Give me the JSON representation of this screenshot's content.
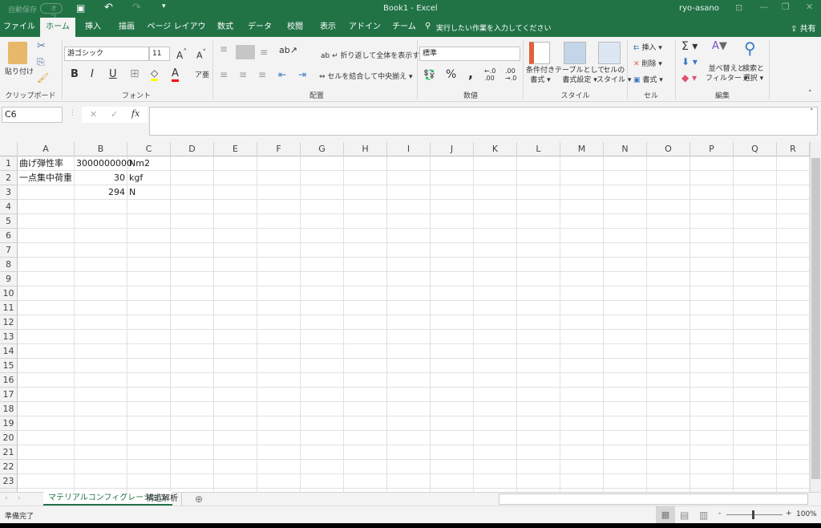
{
  "titlebar": {
    "autosave": "自動保存",
    "autosave_state": "オフ",
    "title": "Book1  -  Excel",
    "user": "ryo-asano"
  },
  "tabs": [
    "ファイル",
    "ホーム",
    "挿入",
    "描画",
    "ページ レイアウト",
    "数式",
    "データ",
    "校閲",
    "表示",
    "アドイン",
    "チーム"
  ],
  "tell_me": "実行したい作業を入力してください",
  "share": "共有",
  "ribbon": {
    "clipboard": {
      "paste": "貼り付け",
      "label": "クリップボード"
    },
    "font": {
      "name": "游ゴシック",
      "size": "11",
      "label": "フォント",
      "bold": "B",
      "italic": "I",
      "underline": "U"
    },
    "alignment": {
      "wrap": "折り返して全体を表示する",
      "merge": "セルを結合して中央揃え",
      "label": "配置"
    },
    "number": {
      "format": "標準",
      "percent": "%",
      "comma": ",",
      "label": "数値"
    },
    "styles": {
      "conditional": [
        "条件付き",
        "書式"
      ],
      "table": [
        "テーブルとして",
        "書式設定"
      ],
      "cell": [
        "セルの",
        "スタイル"
      ],
      "label": "スタイル"
    },
    "cells": {
      "insert": "挿入",
      "delete": "削除",
      "format": "書式",
      "label": "セル"
    },
    "editing": {
      "sort": [
        "並べ替えと",
        "フィルター"
      ],
      "find": [
        "検索と",
        "選択"
      ],
      "label": "編集"
    }
  },
  "formula_bar": {
    "name_box": "C6",
    "fx": "fx",
    "value": ""
  },
  "columns": [
    "A",
    "B",
    "C",
    "D",
    "E",
    "F",
    "G",
    "H",
    "I",
    "J",
    "K",
    "L",
    "M",
    "N",
    "O",
    "P",
    "Q",
    "R"
  ],
  "cells": {
    "A1": "曲げ弾性率",
    "B1": "3000000000",
    "C1": "Nm2",
    "A2": "一点集中荷重",
    "B2": "30",
    "C2": "kgf",
    "B3": "294",
    "C3": "N"
  },
  "sheets": [
    {
      "name": "マテリアルコンフィグレーション",
      "active": true
    },
    {
      "name": "構造解析",
      "active": false
    }
  ],
  "status": {
    "text": "準備完了",
    "zoom": "100%"
  },
  "colors": {
    "brand": "#217346"
  }
}
